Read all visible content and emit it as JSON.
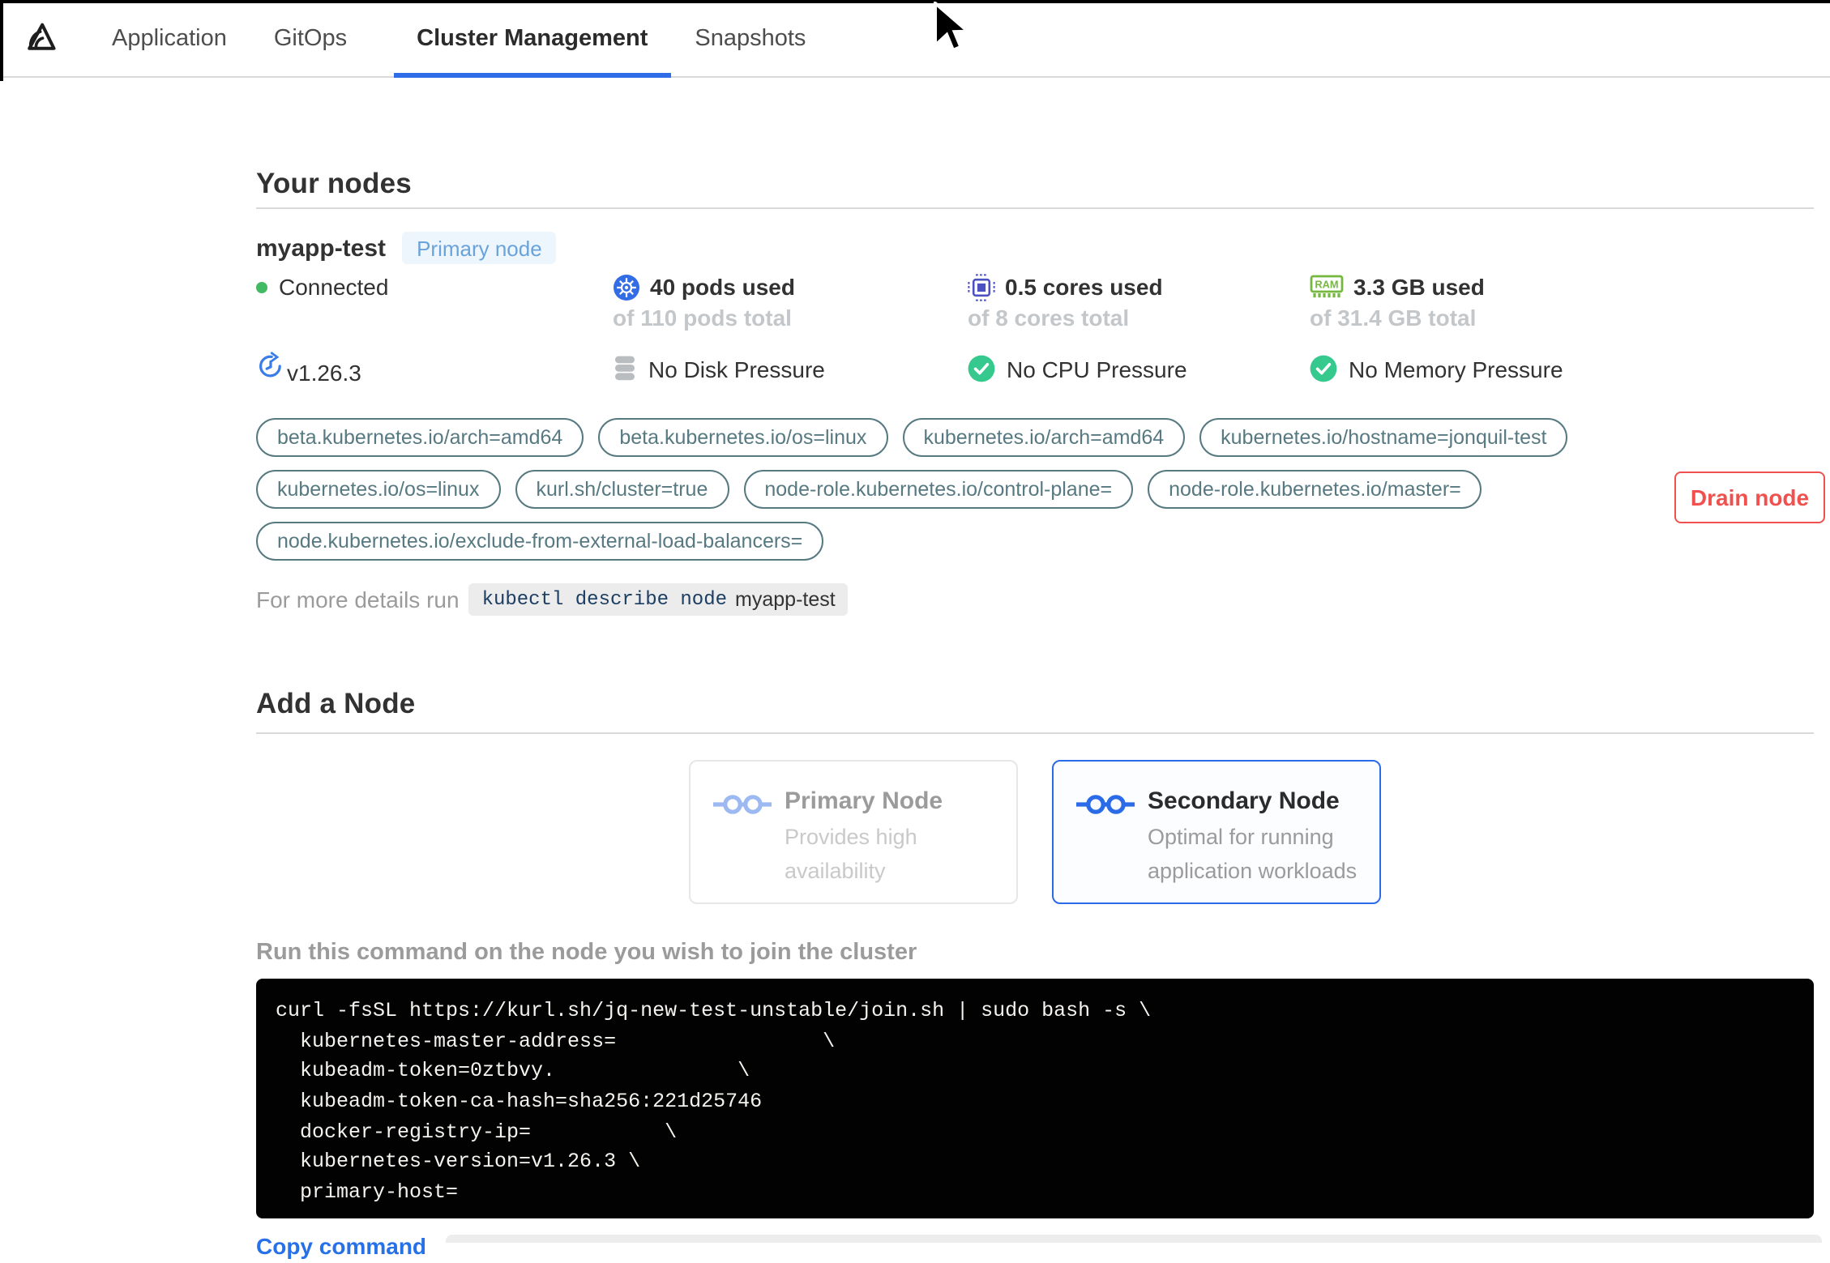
{
  "colors": {
    "accent_blue": "#2f6de8",
    "kubernetes_blue": "#326de6",
    "success_green": "#36c98e",
    "danger_red": "#f0514e",
    "chip_slate": "#577981",
    "ram_green": "#76b83f"
  },
  "topbar": {
    "tabs": [
      {
        "label": "Application"
      },
      {
        "label": "GitOps"
      },
      {
        "label": "Cluster Management"
      },
      {
        "label": "Snapshots"
      }
    ]
  },
  "your_nodes": {
    "title": "Your nodes",
    "node": {
      "name": "myapp-test",
      "badge": "Primary node",
      "status": "Connected",
      "pods_used": "40 pods used",
      "pods_total": "of 110 pods total",
      "cores_used": "0.5 cores used",
      "cores_total": "of 8 cores total",
      "memory_used": "3.3 GB used",
      "memory_total": "of 31.4 GB total",
      "version": "v1.26.3",
      "disk_pressure": "No Disk Pressure",
      "cpu_pressure": "No CPU Pressure",
      "memory_pressure": "No Memory Pressure",
      "labels": [
        "beta.kubernetes.io/arch=amd64",
        "beta.kubernetes.io/os=linux",
        "kubernetes.io/arch=amd64",
        "kubernetes.io/hostname=jonquil-test",
        "kubernetes.io/os=linux",
        "kurl.sh/cluster=true",
        "node-role.kubernetes.io/control-plane=",
        "node-role.kubernetes.io/master=",
        "node.kubernetes.io/exclude-from-external-load-balancers="
      ],
      "details_prefix": "For more details run",
      "details_command": "kubectl describe node",
      "details_node": "myapp-test",
      "drain_button": "Drain node"
    }
  },
  "add_node": {
    "title": "Add a Node",
    "primary_card": {
      "title": "Primary Node",
      "description": "Provides high availability"
    },
    "secondary_card": {
      "title": "Secondary Node",
      "description": "Optimal for running application workloads"
    },
    "instruction": "Run this command on the node you wish to join the cluster",
    "command_lines": [
      "curl -fsSL https://kurl.sh/jq-new-test-unstable/join.sh | sudo bash -s \\",
      "  kubernetes-master-address=                 \\",
      "  kubeadm-token=0ztbvy.               \\",
      "  kubeadm-token-ca-hash=sha256:221d25746",
      "  docker-registry-ip=           \\",
      "  kubernetes-version=v1.26.3 \\",
      "  primary-host="
    ],
    "copy_label": "Copy command"
  }
}
